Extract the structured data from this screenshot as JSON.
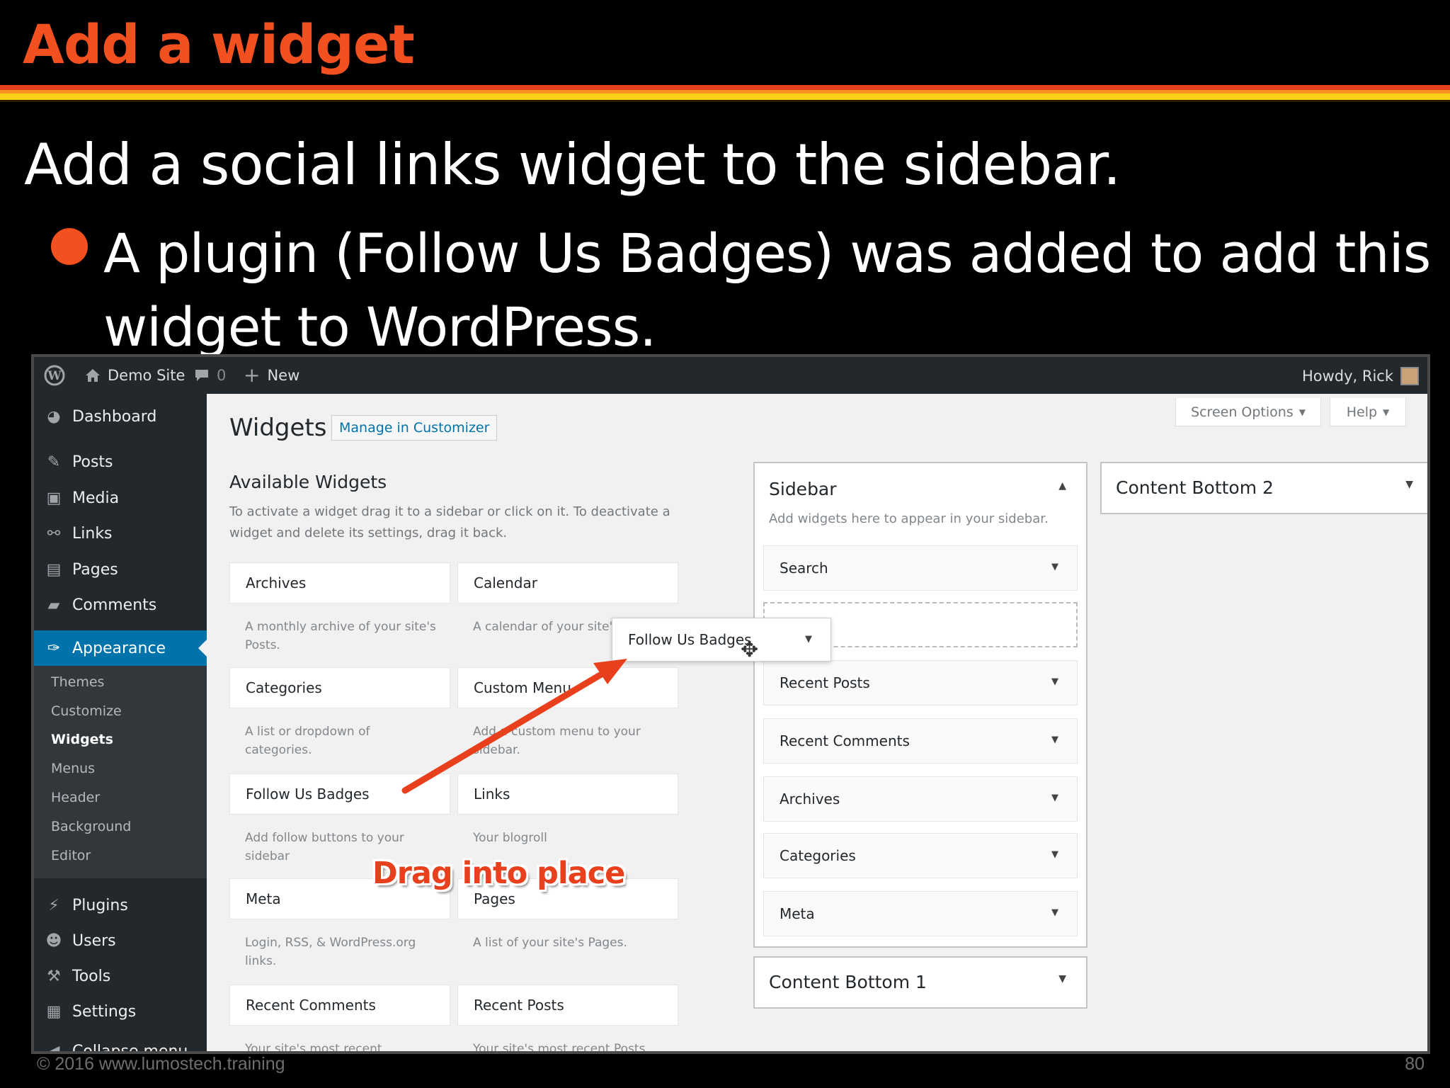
{
  "slide": {
    "title": "Add a widget",
    "subtitle": "Add a social links widget to the sidebar.",
    "bullet": "A plugin (Follow Us Badges) was added to add this widget to WordPress.",
    "footer_left": "© 2016  www.lumostech.training",
    "page_number": "80"
  },
  "colors": {
    "slide_accent": "#f2501f",
    "wp_blue": "#0073aa",
    "wp_dark": "#23282d"
  },
  "adminbar": {
    "site_name": "Demo Site",
    "comments_count": "0",
    "new_label": "New",
    "howdy": "Howdy, Rick"
  },
  "sidebar_menu": {
    "items": [
      {
        "label": "Dashboard",
        "icon": "dashboard-icon"
      },
      {
        "label": "Posts",
        "icon": "pin-icon"
      },
      {
        "label": "Media",
        "icon": "media-icon"
      },
      {
        "label": "Links",
        "icon": "link-icon"
      },
      {
        "label": "Pages",
        "icon": "pages-icon"
      },
      {
        "label": "Comments",
        "icon": "comment-icon"
      },
      {
        "label": "Appearance",
        "icon": "brush-icon"
      },
      {
        "label": "Plugins",
        "icon": "plugin-icon"
      },
      {
        "label": "Users",
        "icon": "user-icon"
      },
      {
        "label": "Tools",
        "icon": "wrench-icon"
      },
      {
        "label": "Settings",
        "icon": "settings-icon"
      },
      {
        "label": "Collapse menu",
        "icon": "collapse-icon"
      }
    ],
    "submenu": [
      "Themes",
      "Customize",
      "Widgets",
      "Menus",
      "Header",
      "Background",
      "Editor"
    ]
  },
  "page": {
    "title": "Widgets",
    "manage_button": "Manage in Customizer",
    "screen_options": "Screen Options",
    "help": "Help"
  },
  "available": {
    "title": "Available Widgets",
    "description": "To activate a widget drag it to a sidebar or click on it. To deactivate a widget and delete its settings, drag it back.",
    "widgets": [
      {
        "name": "Archives",
        "desc": "A monthly archive of your site's Posts."
      },
      {
        "name": "Calendar",
        "desc": "A calendar of your site's Posts."
      },
      {
        "name": "Categories",
        "desc": "A list or dropdown of categories."
      },
      {
        "name": "Custom Menu",
        "desc": "Add a custom menu to your sidebar."
      },
      {
        "name": "Follow Us Badges",
        "desc": "Add follow buttons to your sidebar"
      },
      {
        "name": "Links",
        "desc": "Your blogroll"
      },
      {
        "name": "Meta",
        "desc": "Login, RSS, & WordPress.org links."
      },
      {
        "name": "Pages",
        "desc": "A list of your site's Pages."
      },
      {
        "name": "Recent Comments",
        "desc": "Your site's most recent comments."
      },
      {
        "name": "Recent Posts",
        "desc": "Your site's most recent Posts."
      }
    ]
  },
  "sidebar_area": {
    "title": "Sidebar",
    "description": "Add widgets here to appear in your sidebar.",
    "widgets": [
      "Search",
      "Recent Posts",
      "Recent Comments",
      "Archives",
      "Categories",
      "Meta"
    ]
  },
  "content_bottom_1": {
    "title": "Content Bottom 1"
  },
  "content_bottom_2": {
    "title": "Content Bottom 2"
  },
  "dragging": {
    "label": "Follow Us Badges"
  },
  "annotation": {
    "text": "Drag into place"
  }
}
